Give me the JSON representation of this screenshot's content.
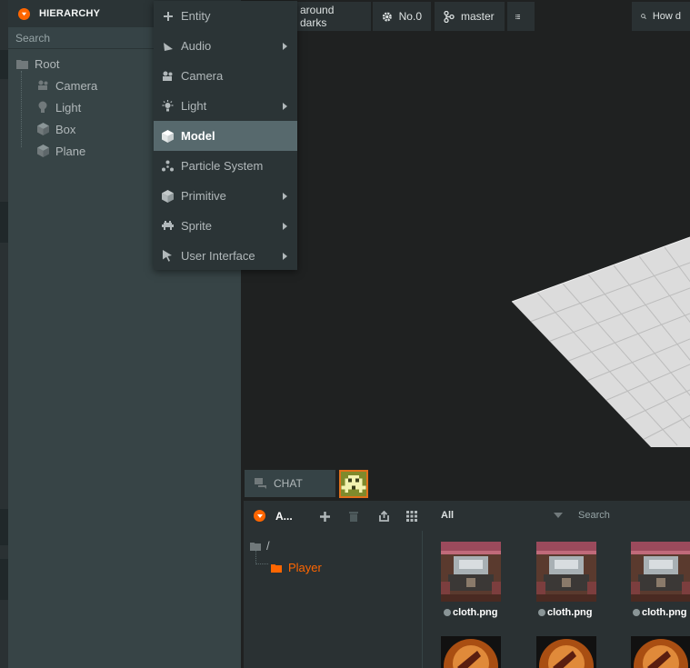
{
  "hierarchy": {
    "title": "HIERARCHY",
    "search_placeholder": "Search",
    "items": [
      {
        "label": "Root",
        "icon": "folder-icon"
      },
      {
        "label": "Camera",
        "icon": "camera-icon"
      },
      {
        "label": "Light",
        "icon": "light-bulb-icon"
      },
      {
        "label": "Box",
        "icon": "cube-icon"
      },
      {
        "label": "Plane",
        "icon": "cube-icon"
      }
    ]
  },
  "toolbar": {
    "project_label": "around darks",
    "settings_label": "No.0",
    "branch_label": "master",
    "search_label": "How d"
  },
  "context_menu": {
    "items": [
      {
        "label": "Entity",
        "icon": "plus-icon",
        "submenu": false
      },
      {
        "label": "Audio",
        "icon": "audio-icon",
        "submenu": true
      },
      {
        "label": "Camera",
        "icon": "camera-icon",
        "submenu": false
      },
      {
        "label": "Light",
        "icon": "light-bulb-icon",
        "submenu": true
      },
      {
        "label": "Model",
        "icon": "cube-icon",
        "submenu": false,
        "active": true
      },
      {
        "label": "Particle System",
        "icon": "particle-icon",
        "submenu": false
      },
      {
        "label": "Primitive",
        "icon": "cube-icon",
        "submenu": true
      },
      {
        "label": "Sprite",
        "icon": "sprite-icon",
        "submenu": true
      },
      {
        "label": "User Interface",
        "icon": "cursor-icon",
        "submenu": true
      }
    ]
  },
  "chat": {
    "label": "CHAT"
  },
  "assets": {
    "title": "A...",
    "filter_label": "All",
    "search_placeholder": "Search",
    "folders": [
      {
        "label": "/"
      },
      {
        "label": "Player"
      }
    ],
    "files": [
      {
        "label": "cloth.png"
      },
      {
        "label": "cloth.png"
      },
      {
        "label": "cloth.png"
      }
    ]
  },
  "colors": {
    "accent": "#ff6600",
    "panel": "#374446",
    "header": "#2b3436",
    "viewport": "#1f2121",
    "active_menu": "#57696d"
  }
}
